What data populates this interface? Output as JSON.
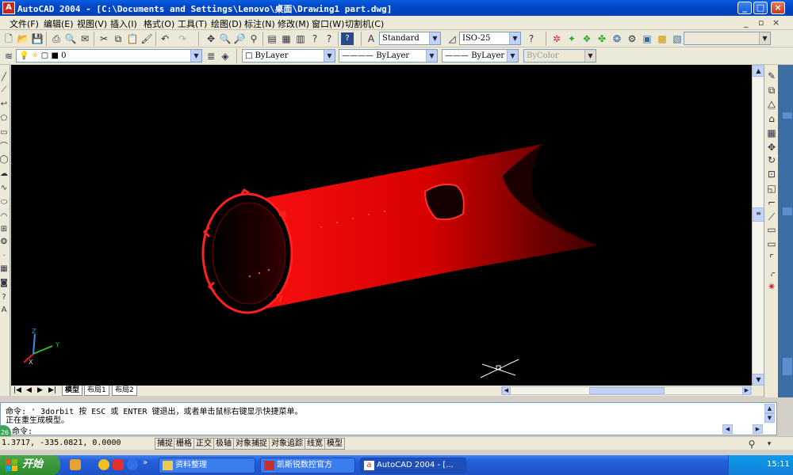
{
  "window": {
    "title": "AutoCAD 2004 - [C:\\Documents and Settings\\Lenovo\\桌面\\Drawing1 part.dwg]",
    "app_icon": "A",
    "minimize": "_",
    "maximize": "□",
    "close": "×"
  },
  "menu": {
    "items": [
      "文件(F)",
      "编辑(E)",
      "视图(V)",
      "插入(I)",
      "格式(O)",
      "工具(T)",
      "绘图(D)",
      "标注(N)",
      "修改(M)",
      "窗口(W)",
      "切割机(C)"
    ],
    "doc_min": "_",
    "doc_restore": "▫",
    "doc_close": "×"
  },
  "toolbar1": {
    "text_style": "Standard",
    "dim_style": "ISO-25"
  },
  "toolbar2": {
    "layer": "0",
    "color": "ByLayer",
    "linetype": "ByLayer",
    "lineweight": "ByLayer",
    "plotstyle": "ByColor"
  },
  "tabs": [
    "模型",
    "布局1",
    "布局2"
  ],
  "tab_nav": [
    "|◀",
    "◀",
    "▶",
    "▶|"
  ],
  "ucs": {
    "x": "X",
    "y": "Y",
    "z": "Z"
  },
  "command": {
    "line1": "命令: '_3dorbit 按 ESC 或 ENTER 键退出，或者单击鼠标右键显示快捷菜单。",
    "line2": "正在重生成模型。",
    "line3": "命令:"
  },
  "status": {
    "coords": "1.3717, -335.0821, 0.0000",
    "buttons": [
      "捕捉",
      "栅格",
      "正交",
      "极轴",
      "对象捕捉",
      "对象追踪",
      "线宽",
      "模型"
    ]
  },
  "taskbar": {
    "start": "开始",
    "tasks": [
      "资料整理",
      "凯斯锐数控官方",
      "AutoCAD 2004 - [..."
    ],
    "clock": "15:11",
    "more": "»"
  },
  "badge": "26",
  "colors": {
    "part_red": "#e00000",
    "titlebar": "#0346c8",
    "taskbar": "#245edb",
    "viewport_bg": "#000000"
  }
}
